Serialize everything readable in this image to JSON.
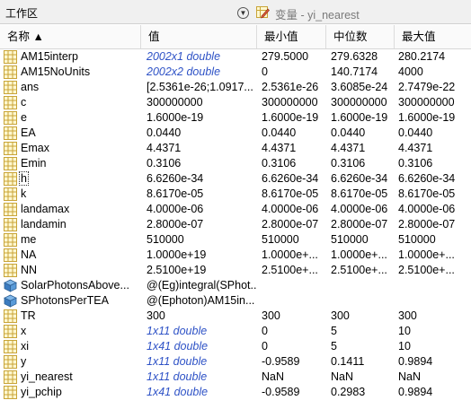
{
  "panel": {
    "title": "工作区",
    "menu_icon": "chevron-down-icon",
    "editor_title": "变量 - yi_nearest"
  },
  "columns": {
    "name": "名称 ▲",
    "value": "值",
    "min": "最小值",
    "median": "中位数",
    "max": "最大值"
  },
  "colors": {
    "header_bg": "#fafafa",
    "italic_value": "#2e52c6",
    "grid_icon_border": "#c8a437",
    "grid_icon_fill": "#fff3b3"
  },
  "variables": [
    {
      "icon": "matrix-icon",
      "name": "AM15interp",
      "value": "2002x1 double",
      "italic": true,
      "min": "279.5000",
      "median": "279.6328",
      "max": "280.2174"
    },
    {
      "icon": "matrix-icon",
      "name": "AM15NoUnits",
      "value": "2002x2 double",
      "italic": true,
      "min": "0",
      "median": "140.7174",
      "max": "4000"
    },
    {
      "icon": "matrix-icon",
      "name": "ans",
      "value": "[2.5361e-26;1.0917...",
      "italic": false,
      "min": "2.5361e-26",
      "median": "3.6085e-24",
      "max": "2.7479e-22"
    },
    {
      "icon": "matrix-icon",
      "name": "c",
      "value": "300000000",
      "italic": false,
      "min": "300000000",
      "median": "300000000",
      "max": "300000000"
    },
    {
      "icon": "matrix-icon",
      "name": "e",
      "value": "1.6000e-19",
      "italic": false,
      "min": "1.6000e-19",
      "median": "1.6000e-19",
      "max": "1.6000e-19"
    },
    {
      "icon": "matrix-icon",
      "name": "EA",
      "value": "0.0440",
      "italic": false,
      "min": "0.0440",
      "median": "0.0440",
      "max": "0.0440"
    },
    {
      "icon": "matrix-icon",
      "name": "Emax",
      "value": "4.4371",
      "italic": false,
      "min": "4.4371",
      "median": "4.4371",
      "max": "4.4371"
    },
    {
      "icon": "matrix-icon",
      "name": "Emin",
      "value": "0.3106",
      "italic": false,
      "min": "0.3106",
      "median": "0.3106",
      "max": "0.3106"
    },
    {
      "icon": "matrix-icon",
      "name": "h",
      "value": "6.6260e-34",
      "italic": false,
      "min": "6.6260e-34",
      "median": "6.6260e-34",
      "max": "6.6260e-34"
    },
    {
      "icon": "matrix-icon",
      "name": "k",
      "value": "8.6170e-05",
      "italic": false,
      "min": "8.6170e-05",
      "median": "8.6170e-05",
      "max": "8.6170e-05"
    },
    {
      "icon": "matrix-icon",
      "name": "landamax",
      "value": "4.0000e-06",
      "italic": false,
      "min": "4.0000e-06",
      "median": "4.0000e-06",
      "max": "4.0000e-06"
    },
    {
      "icon": "matrix-icon",
      "name": "landamin",
      "value": "2.8000e-07",
      "italic": false,
      "min": "2.8000e-07",
      "median": "2.8000e-07",
      "max": "2.8000e-07"
    },
    {
      "icon": "matrix-icon",
      "name": "me",
      "value": "510000",
      "italic": false,
      "min": "510000",
      "median": "510000",
      "max": "510000"
    },
    {
      "icon": "matrix-icon",
      "name": "NA",
      "value": "1.0000e+19",
      "italic": false,
      "min": "1.0000e+...",
      "median": "1.0000e+...",
      "max": "1.0000e+..."
    },
    {
      "icon": "matrix-icon",
      "name": "NN",
      "value": "2.5100e+19",
      "italic": false,
      "min": "2.5100e+...",
      "median": "2.5100e+...",
      "max": "2.5100e+..."
    },
    {
      "icon": "function-handle-icon",
      "name": "SolarPhotonsAbove...",
      "value": "@(Eg)integral(SPhot...",
      "italic": false,
      "min": "",
      "median": "",
      "max": ""
    },
    {
      "icon": "function-handle-icon",
      "name": "SPhotonsPerTEA",
      "value": "@(Ephoton)AM15in...",
      "italic": false,
      "min": "",
      "median": "",
      "max": ""
    },
    {
      "icon": "matrix-icon",
      "name": "TR",
      "value": "300",
      "italic": false,
      "min": "300",
      "median": "300",
      "max": "300"
    },
    {
      "icon": "matrix-icon",
      "name": "x",
      "value": "1x11 double",
      "italic": true,
      "min": "0",
      "median": "5",
      "max": "10"
    },
    {
      "icon": "matrix-icon",
      "name": "xi",
      "value": "1x41 double",
      "italic": true,
      "min": "0",
      "median": "5",
      "max": "10"
    },
    {
      "icon": "matrix-icon",
      "name": "y",
      "value": "1x11 double",
      "italic": true,
      "min": "-0.9589",
      "median": "0.1411",
      "max": "0.9894"
    },
    {
      "icon": "matrix-icon",
      "name": "yi_nearest",
      "value": "1x11 double",
      "italic": true,
      "min": "NaN",
      "median": "NaN",
      "max": "NaN"
    },
    {
      "icon": "matrix-icon",
      "name": "yi_pchip",
      "value": "1x41 double",
      "italic": true,
      "min": "-0.9589",
      "median": "0.2983",
      "max": "0.9894"
    }
  ]
}
